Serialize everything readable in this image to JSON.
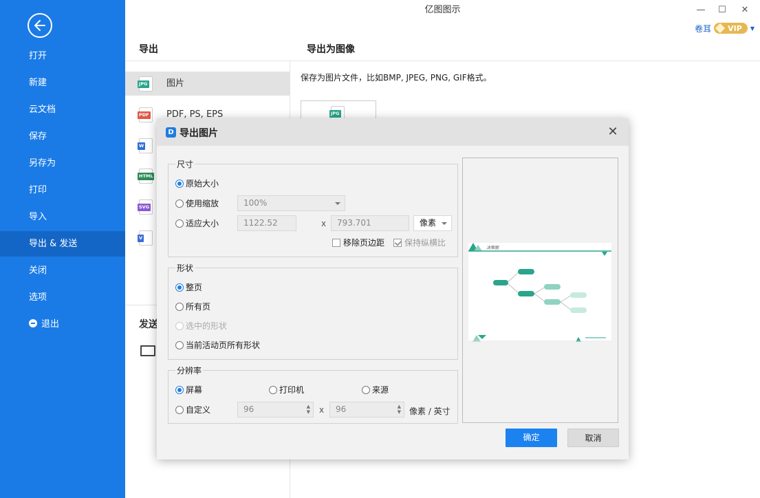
{
  "app": {
    "title": "亿图图示"
  },
  "window_controls": {
    "minimize": "—",
    "maximize": "☐",
    "close": "✕"
  },
  "user": {
    "name": "卷耳",
    "vip_label": "VIP"
  },
  "sidebar": {
    "items": [
      {
        "label": "打开"
      },
      {
        "label": "新建"
      },
      {
        "label": "云文档"
      },
      {
        "label": "保存"
      },
      {
        "label": "另存为"
      },
      {
        "label": "打印"
      },
      {
        "label": "导入"
      },
      {
        "label": "导出 & 发送",
        "active": true
      },
      {
        "label": "关闭"
      },
      {
        "label": "选项"
      },
      {
        "label": "退出",
        "icon": "exit-icon"
      }
    ]
  },
  "export_panel": {
    "heading": "导出",
    "formats": [
      {
        "label": "图片",
        "tag": "JPG",
        "color": "#2aa58b",
        "active": true
      },
      {
        "label": "PDF, PS, EPS",
        "tag": "PDF",
        "color": "#e0574b"
      },
      {
        "label": "",
        "tag": "W",
        "color": "#2f6fd6"
      },
      {
        "label": "",
        "tag": "HTML",
        "color": "#2e8b57"
      },
      {
        "label": "",
        "tag": "SVG",
        "color": "#8a5bd6"
      },
      {
        "label": "",
        "tag": "V",
        "color": "#3b6fd6"
      }
    ],
    "send_heading": "发送"
  },
  "image_panel": {
    "heading": "导出为图像",
    "description": "保存为图片文件，比如BMP, JPEG, PNG, GIF格式。",
    "thumb_tag": "JPG"
  },
  "dialog": {
    "title": "导出图片",
    "logo": "D",
    "size_group": {
      "legend": "尺寸",
      "original_label": "原始大小",
      "scale_label": "使用缩放",
      "scale_value": "100%",
      "fit_label": "适应大小",
      "width_value": "1122.52",
      "x_label": "x",
      "height_value": "793.701",
      "unit_value": "像素",
      "remove_margin_label": "移除页边距",
      "keep_ratio_label": "保持纵横比",
      "remove_margin_checked": false,
      "keep_ratio_checked": true
    },
    "shape_group": {
      "legend": "形状",
      "options": [
        {
          "label": "整页",
          "checked": true,
          "disabled": false
        },
        {
          "label": "所有页",
          "checked": false,
          "disabled": false
        },
        {
          "label": "选中的形状",
          "checked": false,
          "disabled": true
        },
        {
          "label": "当前活动页所有形状",
          "checked": false,
          "disabled": false
        }
      ]
    },
    "resolution_group": {
      "legend": "分辨率",
      "screen_label": "屏幕",
      "printer_label": "打印机",
      "source_label": "来源",
      "custom_label": "自定义",
      "dpi_x": "96",
      "x_label": "x",
      "dpi_y": "96",
      "unit_label": "像素 / 英寸"
    },
    "preview": {
      "page_title": "决策图"
    },
    "ok_label": "确定",
    "cancel_label": "取消"
  }
}
